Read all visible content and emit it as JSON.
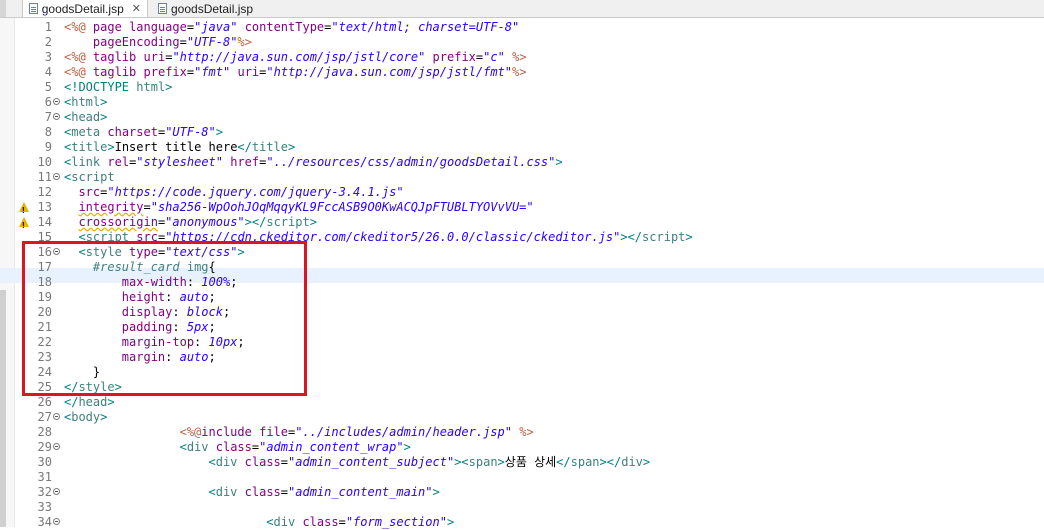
{
  "tabs": [
    {
      "label": "goodsDetail.jsp",
      "active": true,
      "closable": true
    },
    {
      "label": "goodsDetail.jsp",
      "active": false,
      "closable": false
    }
  ],
  "lines": [
    {
      "n": "1",
      "fold": false,
      "warn": false,
      "html": "<span class='jsp'>&lt;%@</span> <span class='a'>page</span> <span class='a'>language</span>=<span class='s'>\"java\"</span> <span class='a'>contentType</span>=<span class='s'>\"text/html; charset=UTF-8\"</span>"
    },
    {
      "n": "2",
      "fold": false,
      "warn": false,
      "html": "    <span class='a'>pageEncoding</span>=<span class='s'>\"UTF-8\"</span><span class='jsp'>%&gt;</span>"
    },
    {
      "n": "3",
      "fold": false,
      "warn": false,
      "html": "<span class='jsp'>&lt;%@</span> <span class='a'>taglib</span> <span class='a'>uri</span>=<span class='s'>\"http://java.sun.com/jsp/jstl/core\"</span> <span class='a'>prefix</span>=<span class='s'>\"c\"</span> <span class='jsp'>%&gt;</span>"
    },
    {
      "n": "4",
      "fold": false,
      "warn": false,
      "html": "<span class='jsp'>&lt;%@</span> <span class='a'>taglib</span> <span class='a'>prefix</span>=<span class='s'>\"fmt\"</span> <span class='a'>uri</span>=<span class='s'>\"http://java.sun.com/jsp/jstl/fmt\"</span><span class='jsp'>%&gt;</span>"
    },
    {
      "n": "5",
      "fold": false,
      "warn": false,
      "html": "<span class='dt'>&lt;!DOCTYPE</span> <span class='t'>html</span><span class='dt'>&gt;</span>"
    },
    {
      "n": "6",
      "fold": true,
      "warn": false,
      "html": "<span class='b'>&lt;</span><span class='t'>html</span><span class='b'>&gt;</span>"
    },
    {
      "n": "7",
      "fold": true,
      "warn": false,
      "html": "<span class='b'>&lt;</span><span class='t'>head</span><span class='b'>&gt;</span>"
    },
    {
      "n": "8",
      "fold": false,
      "warn": false,
      "html": "<span class='b'>&lt;</span><span class='t'>meta</span> <span class='a'>charset</span>=<span class='s'>\"UTF-8\"</span><span class='b'>&gt;</span>"
    },
    {
      "n": "9",
      "fold": false,
      "warn": false,
      "html": "<span class='b'>&lt;</span><span class='t'>title</span><span class='b'>&gt;</span>Insert title here<span class='b'>&lt;/</span><span class='t'>title</span><span class='b'>&gt;</span>"
    },
    {
      "n": "10",
      "fold": false,
      "warn": false,
      "html": "<span class='b'>&lt;</span><span class='t'>link</span> <span class='a'>rel</span>=<span class='s'>\"stylesheet\"</span> <span class='a'>href</span>=<span class='s'>\"../resources/css/admin/goodsDetail.css\"</span><span class='b'>&gt;</span>"
    },
    {
      "n": "11",
      "fold": true,
      "warn": false,
      "html": "<span class='b'>&lt;</span><span class='t'>script</span>"
    },
    {
      "n": "12",
      "fold": false,
      "warn": false,
      "html": "  <span class='a'>src</span>=<span class='s'>\"https://code.jquery.com/jquery-3.4.1.js\"</span>"
    },
    {
      "n": "13",
      "fold": false,
      "warn": true,
      "html": "  <span class='a underline'>integrity</span>=<span class='s'>\"sha256-WpOohJOqMqqyKL9FccASB9O0KwACQJpFTUBLTYOVvVU=\"</span>"
    },
    {
      "n": "14",
      "fold": false,
      "warn": true,
      "html": "  <span class='a underline'>crossorigin</span>=<span class='s'>\"anonymous\"</span><span class='b'>&gt;&lt;/</span><span class='t'>script</span><span class='b'>&gt;</span>"
    },
    {
      "n": "15",
      "fold": false,
      "warn": false,
      "html": "  <span class='b'>&lt;</span><span class='t'>script</span> <span class='a'>src</span>=<span class='s'>\"https://cdn.ckeditor.com/ckeditor5/26.0.0/classic/ckeditor.js\"</span><span class='b'>&gt;&lt;/</span><span class='t'>script</span><span class='b'>&gt;</span>"
    },
    {
      "n": "16",
      "fold": true,
      "warn": false,
      "html": "  <span class='b'>&lt;</span><span class='t'>style</span> <span class='a'>type</span>=<span class='s'>\"text/css\"</span><span class='b'>&gt;</span>"
    },
    {
      "n": "17",
      "fold": false,
      "warn": false,
      "html": "    <span class='css-sel'>#result_card</span> <span class='t'>img</span>{"
    },
    {
      "n": "18",
      "fold": false,
      "warn": false,
      "html": "        <span class='css-prop'>max-width</span>: <span class='css-val'>100%</span>;"
    },
    {
      "n": "19",
      "fold": false,
      "warn": false,
      "html": "        <span class='css-prop'>height</span>: <span class='css-val'>auto</span>;"
    },
    {
      "n": "20",
      "fold": false,
      "warn": false,
      "html": "        <span class='css-prop'>display</span>: <span class='css-val'>block</span>;"
    },
    {
      "n": "21",
      "fold": false,
      "warn": false,
      "html": "        <span class='css-prop'>padding</span>: <span class='css-val'>5px</span>;"
    },
    {
      "n": "22",
      "fold": false,
      "warn": false,
      "html": "        <span class='css-prop'>margin-top</span>: <span class='css-val'>10px</span>;"
    },
    {
      "n": "23",
      "fold": false,
      "warn": false,
      "html": "        <span class='css-prop'>margin</span>: <span class='css-val'>auto</span>;"
    },
    {
      "n": "24",
      "fold": false,
      "warn": false,
      "html": "    }"
    },
    {
      "n": "25",
      "fold": false,
      "warn": false,
      "html": "<span class='b'>&lt;/</span><span class='t'>style</span><span class='b'>&gt;</span>"
    },
    {
      "n": "26",
      "fold": false,
      "warn": false,
      "html": "<span class='b'>&lt;/</span><span class='t'>head</span><span class='b'>&gt;</span>"
    },
    {
      "n": "27",
      "fold": true,
      "warn": false,
      "html": "<span class='b'>&lt;</span><span class='t'>body</span><span class='b'>&gt;</span>"
    },
    {
      "n": "28",
      "fold": false,
      "warn": false,
      "html": "                <span class='jsp'>&lt;%@</span><span class='a'>include</span> <span class='a'>file</span>=<span class='s'>\"../includes/admin/header.jsp\"</span> <span class='jsp'>%&gt;</span>"
    },
    {
      "n": "29",
      "fold": true,
      "warn": false,
      "html": "                <span class='b'>&lt;</span><span class='t'>div</span> <span class='a'>class</span>=<span class='s'>\"admin_content_wrap\"</span><span class='b'>&gt;</span>"
    },
    {
      "n": "30",
      "fold": false,
      "warn": false,
      "html": "                    <span class='b'>&lt;</span><span class='t'>div</span> <span class='a'>class</span>=<span class='s'>\"admin_content_subject\"</span><span class='b'>&gt;&lt;</span><span class='t'>span</span><span class='b'>&gt;</span>상품 상세<span class='b'>&lt;/</span><span class='t'>span</span><span class='b'>&gt;&lt;/</span><span class='t'>div</span><span class='b'>&gt;</span>"
    },
    {
      "n": "31",
      "fold": false,
      "warn": false,
      "html": ""
    },
    {
      "n": "32",
      "fold": true,
      "warn": false,
      "html": "                    <span class='b'>&lt;</span><span class='t'>div</span> <span class='a'>class</span>=<span class='s'>\"admin_content_main\"</span><span class='b'>&gt;</span>"
    },
    {
      "n": "33",
      "fold": false,
      "warn": false,
      "html": ""
    },
    {
      "n": "34",
      "fold": true,
      "warn": false,
      "html": "                            <span class='b'>&lt;</span><span class='t'>div</span> <span class='a'>class</span>=<span class='s'>\"form_section\"</span><span class='b'>&gt;</span>"
    }
  ]
}
